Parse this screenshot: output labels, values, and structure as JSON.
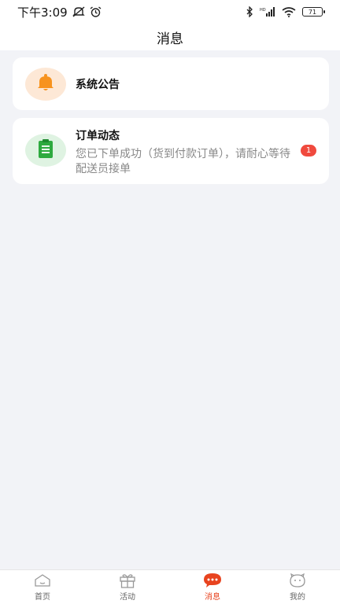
{
  "status_bar": {
    "time": "下午3:09",
    "battery": "71"
  },
  "header": {
    "title": "消息"
  },
  "messages": [
    {
      "title": "系统公告",
      "icon": "bell-icon",
      "icon_color": "#f7931e",
      "bg_color": "#fde8d6"
    },
    {
      "title": "订单动态",
      "text": "您已下单成功（货到付款订单），请耐心等待配送员接单",
      "badge": "1",
      "icon": "clipboard-icon",
      "icon_color": "#2eaa3f",
      "bg_color": "#dff3e2"
    }
  ],
  "tab_bar": {
    "items": [
      {
        "label": "首页",
        "icon": "home-icon",
        "active": false
      },
      {
        "label": "活动",
        "icon": "gift-icon",
        "active": false
      },
      {
        "label": "消息",
        "icon": "chat-icon",
        "active": true
      },
      {
        "label": "我的",
        "icon": "profile-icon",
        "active": false
      }
    ],
    "active_color": "#e8431f"
  }
}
